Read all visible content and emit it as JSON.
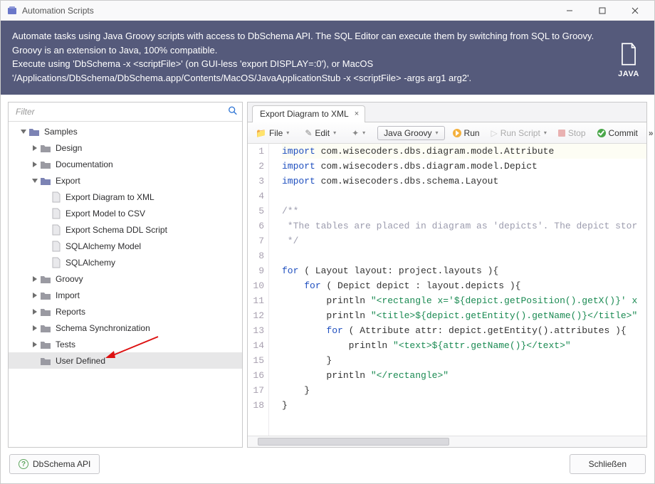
{
  "window": {
    "title": "Automation Scripts",
    "minimize_label": "Minimize",
    "maximize_label": "Maximize",
    "close_label": "Close"
  },
  "banner": {
    "line1": "Automate tasks using Java Groovy scripts with access to DbSchema API. The SQL Editor can execute them by switching from SQL to Groovy. Groovy is an extension to Java, 100% compatible.",
    "line2": "Execute using 'DbSchema -x <scriptFile>' (on GUI-less 'export DISPLAY=:0'), or MacOS '/Applications/DbSchema/DbSchema.app/Contents/MacOS/JavaApplicationStub -x <scriptFile> -args arg1 arg2'.",
    "badge": "JAVA"
  },
  "filter": {
    "placeholder": "Filter"
  },
  "tree": [
    {
      "depth": 0,
      "kind": "folder-open",
      "disc": "expanded",
      "label": "Samples"
    },
    {
      "depth": 1,
      "kind": "folder-closed",
      "disc": "collapsed",
      "label": "Design"
    },
    {
      "depth": 1,
      "kind": "folder-closed",
      "disc": "collapsed",
      "label": "Documentation"
    },
    {
      "depth": 1,
      "kind": "folder-open",
      "disc": "expanded",
      "label": "Export"
    },
    {
      "depth": 2,
      "kind": "file",
      "disc": "none",
      "label": "Export Diagram to XML"
    },
    {
      "depth": 2,
      "kind": "file",
      "disc": "none",
      "label": "Export Model to CSV"
    },
    {
      "depth": 2,
      "kind": "file",
      "disc": "none",
      "label": "Export Schema DDL Script"
    },
    {
      "depth": 2,
      "kind": "file",
      "disc": "none",
      "label": "SQLAlchemy Model"
    },
    {
      "depth": 2,
      "kind": "file",
      "disc": "none",
      "label": "SQLAlchemy"
    },
    {
      "depth": 1,
      "kind": "folder-closed",
      "disc": "collapsed",
      "label": "Groovy"
    },
    {
      "depth": 1,
      "kind": "folder-closed",
      "disc": "collapsed",
      "label": "Import"
    },
    {
      "depth": 1,
      "kind": "folder-closed",
      "disc": "collapsed",
      "label": "Reports"
    },
    {
      "depth": 1,
      "kind": "folder-closed",
      "disc": "collapsed",
      "label": "Schema Synchronization"
    },
    {
      "depth": 1,
      "kind": "folder-closed",
      "disc": "collapsed",
      "label": "Tests"
    },
    {
      "depth": 1,
      "kind": "folder-closed",
      "disc": "none",
      "label": "User Defined",
      "selected": true
    }
  ],
  "editor_tab": {
    "title": "Export Diagram to XML",
    "close": "×"
  },
  "toolbar": {
    "file": "File",
    "edit": "Edit",
    "language": "Java Groovy",
    "run": "Run",
    "run_script": "Run Script",
    "stop": "Stop",
    "commit": "Commit"
  },
  "code": {
    "lines": [
      {
        "n": 1,
        "html": "<span class='kw'>import</span> com.wisecoders.dbs.diagram.model.Attribute",
        "current": true
      },
      {
        "n": 2,
        "html": "<span class='kw'>import</span> com.wisecoders.dbs.diagram.model.Depict"
      },
      {
        "n": 3,
        "html": "<span class='kw'>import</span> com.wisecoders.dbs.schema.Layout"
      },
      {
        "n": 4,
        "html": ""
      },
      {
        "n": 5,
        "html": "<span class='cm'>/**</span>"
      },
      {
        "n": 6,
        "html": "<span class='cm'> *The tables are placed in diagram as 'depicts'. The depict stor</span>"
      },
      {
        "n": 7,
        "html": "<span class='cm'> */</span>"
      },
      {
        "n": 8,
        "html": ""
      },
      {
        "n": 9,
        "html": "<span class='kw'>for</span> ( Layout layout: project.layouts ){"
      },
      {
        "n": 10,
        "html": "    <span class='kw'>for</span> ( Depict depict : layout.depicts ){"
      },
      {
        "n": 11,
        "html": "        println <span class='str'>\"&lt;rectangle x='${depict.getPosition().getX()}' x</span>"
      },
      {
        "n": 12,
        "html": "        println <span class='str'>\"&lt;title&gt;${depict.getEntity().getName()}&lt;/title&gt;\"</span>"
      },
      {
        "n": 13,
        "html": "        <span class='kw'>for</span> ( Attribute attr: depict.getEntity().attributes ){"
      },
      {
        "n": 14,
        "html": "            println <span class='str'>\"&lt;text&gt;${attr.getName()}&lt;/text&gt;\"</span>"
      },
      {
        "n": 15,
        "html": "        }"
      },
      {
        "n": 16,
        "html": "        println <span class='str'>\"&lt;/rectangle&gt;\"</span>"
      },
      {
        "n": 17,
        "html": "    }"
      },
      {
        "n": 18,
        "html": "}"
      }
    ]
  },
  "footer": {
    "api": "DbSchema API",
    "close": "Schließen"
  },
  "colors": {
    "banner": "#555a7b",
    "keyword": "#1f4fbf",
    "string": "#1a8a52",
    "comment": "#9c9cae"
  }
}
